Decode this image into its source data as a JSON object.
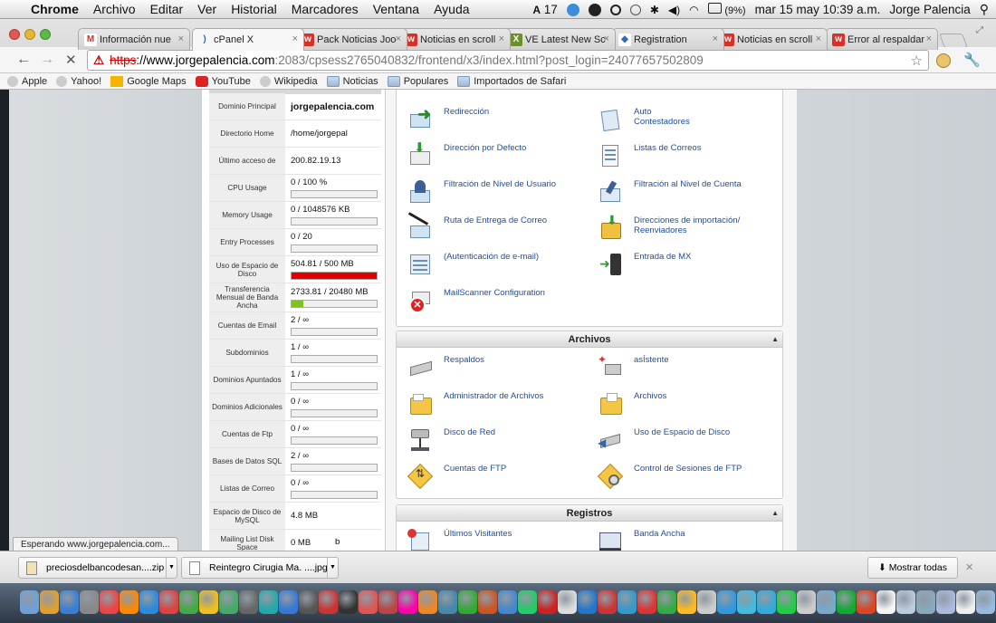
{
  "menubar": {
    "app": "Chrome",
    "items": [
      "Archivo",
      "Editar",
      "Ver",
      "Historial",
      "Marcadores",
      "Ventana",
      "Ayuda"
    ],
    "status_num": "17",
    "battery": "(9%)",
    "datetime": "mar 15 may  10:39 a.m.",
    "user": "Jorge Palencia"
  },
  "tabs": [
    {
      "label": "Información nue",
      "fav": "M",
      "color": "#d93025",
      "bg": "#fff"
    },
    {
      "label": "cPanel X",
      "fav": ")",
      "color": "#2a6ebb",
      "bg": "#f7f7f7"
    },
    {
      "label": "Pack Noticias Joo",
      "fav": "w",
      "color": "#fff",
      "bg": "#d4332b"
    },
    {
      "label": "Noticias en scroll",
      "fav": "w",
      "color": "#fff",
      "bg": "#d4332b"
    },
    {
      "label": "VE Latest New Sc",
      "fav": "X",
      "color": "#fff",
      "bg": "#6b8f2a"
    },
    {
      "label": "Registration",
      "fav": "◆",
      "color": "#2a6ebb",
      "bg": "#fff"
    },
    {
      "label": "Noticias en scroll",
      "fav": "w",
      "color": "#fff",
      "bg": "#d4332b"
    },
    {
      "label": "Error al respaldar",
      "fav": "w",
      "color": "#fff",
      "bg": "#d4332b"
    }
  ],
  "omnibox": {
    "scheme": "https",
    "domain": "://www.jorgepalencia.com",
    "rest": ":2083/cpsess2765040832/frontend/x3/index.html?post_login=24077657502809"
  },
  "bookmarks": [
    "Apple",
    "Yahoo!",
    "Google Maps",
    "YouTube",
    "Wikipedia",
    "Noticias",
    "Populares",
    "Importados de Safari"
  ],
  "stats": [
    {
      "label": "Dominio Principal",
      "value": "jorgepalencia.com",
      "bold": true
    },
    {
      "label": "Directorio Home",
      "value": "/home/jorgepal"
    },
    {
      "label": "Último acceso de",
      "value": "200.82.19.13"
    },
    {
      "label": "CPU Usage",
      "value": "0 / 100 %",
      "bar": 0,
      "bar_color": "#7ec322"
    },
    {
      "label": "Memory Usage",
      "value": "0 / 1048576 KB",
      "bar": 0,
      "bar_color": "#7ec322"
    },
    {
      "label": "Entry Processes",
      "value": "0 / 20",
      "bar": 0,
      "bar_color": "#7ec322"
    },
    {
      "label": "Uso de Espacio de Disco",
      "value": "504.81 / 500 MB",
      "bar": 1.0,
      "bar_color": "#e00000"
    },
    {
      "label": "Transferencia Mensual de Banda Ancha",
      "value": "2733.81 / 20480 MB",
      "bar": 0.133,
      "bar_color": "#7ec322"
    },
    {
      "label": "Cuentas de Email",
      "value": "2 / ∞",
      "bar": 0,
      "bar_color": "#7ec322"
    },
    {
      "label": "Subdominios",
      "value": "1 / ∞",
      "bar": 0,
      "bar_color": "#7ec322"
    },
    {
      "label": "Dominios Apuntados",
      "value": "1 / ∞",
      "bar": 0,
      "bar_color": "#7ec322"
    },
    {
      "label": "Dominios Adicionales",
      "value": "0 / ∞",
      "bar": 0,
      "bar_color": "#7ec322"
    },
    {
      "label": "Cuentas de Ftp",
      "value": "0 / ∞",
      "bar": 0,
      "bar_color": "#7ec322"
    },
    {
      "label": "Bases de Datos SQL",
      "value": "2 / ∞",
      "bar": 0,
      "bar_color": "#7ec322"
    },
    {
      "label": "Listas de Correo",
      "value": "0 / ∞",
      "bar": 0,
      "bar_color": "#7ec322"
    },
    {
      "label": "Espacio de Disco de MySQL",
      "value": "4.8 MB"
    },
    {
      "label": "Mailing List Disk Space",
      "value": "0 MB"
    }
  ],
  "stats_partial": "b",
  "mail": {
    "items": [
      {
        "left": "Redirección",
        "right": "Auto\nContestadores"
      },
      {
        "left": "Dirección por Defecto",
        "right": "Listas de Correos"
      },
      {
        "left": "Filtración de Nivel de Usuario",
        "right": "Filtración al Nivel de Cuenta"
      },
      {
        "left": "Ruta de Entrega de Correo",
        "right": "Direcciones de importación/\nReenviadores"
      },
      {
        "left": "(Autenticación de e-mail)",
        "right": "Entrada de MX"
      },
      {
        "left": "MailScanner Configuration",
        "right": ""
      }
    ]
  },
  "archivos": {
    "title": "Archivos",
    "items": [
      {
        "left": "Respaldos",
        "right": "asÍstente"
      },
      {
        "left": "Administrador de Archivos",
        "right": "Archivos"
      },
      {
        "left": "Disco de Red",
        "right": "Uso de Espacio de Disco"
      },
      {
        "left": "Cuentas de FTP",
        "right": "Control de Sesiones de FTP"
      }
    ]
  },
  "registros": {
    "title": "Registros",
    "items": [
      {
        "left": "Últimos Visitantes",
        "right": "Banda Ancha"
      }
    ]
  },
  "status_text": "Esperando www.jorgepalencia.com...",
  "downloads": [
    {
      "name": "preciosdelbancodesan....zip"
    },
    {
      "name": "Reintegro Cirugia Ma. ....jpg"
    }
  ],
  "show_all": "Mostrar todas",
  "dock_colors": [
    "#6fa0d8",
    "#e0a030",
    "#3a7fd5",
    "#888",
    "#e44",
    "#f80",
    "#2a8ade",
    "#e04040",
    "#4a4",
    "#f0c020",
    "#4a6",
    "#666",
    "#2aa",
    "#3579d6",
    "#555",
    "#c33",
    "#333",
    "#d55",
    "#b44",
    "#f0a",
    "#e82",
    "#48a",
    "#3a3",
    "#c52",
    "#48c",
    "#2c6",
    "#c22",
    "#ddd",
    "#27c",
    "#c33",
    "#39c",
    "#d33",
    "#3a4",
    "#fb2",
    "#ccc",
    "#39d",
    "#4bd",
    "#3ad",
    "#2c4",
    "#ccc",
    "#7ac",
    "#1a3",
    "#d42",
    "#f5f5f5",
    "#bcd",
    "#8ab",
    "#abd",
    "#eee",
    "#9bd",
    "#bbb"
  ]
}
